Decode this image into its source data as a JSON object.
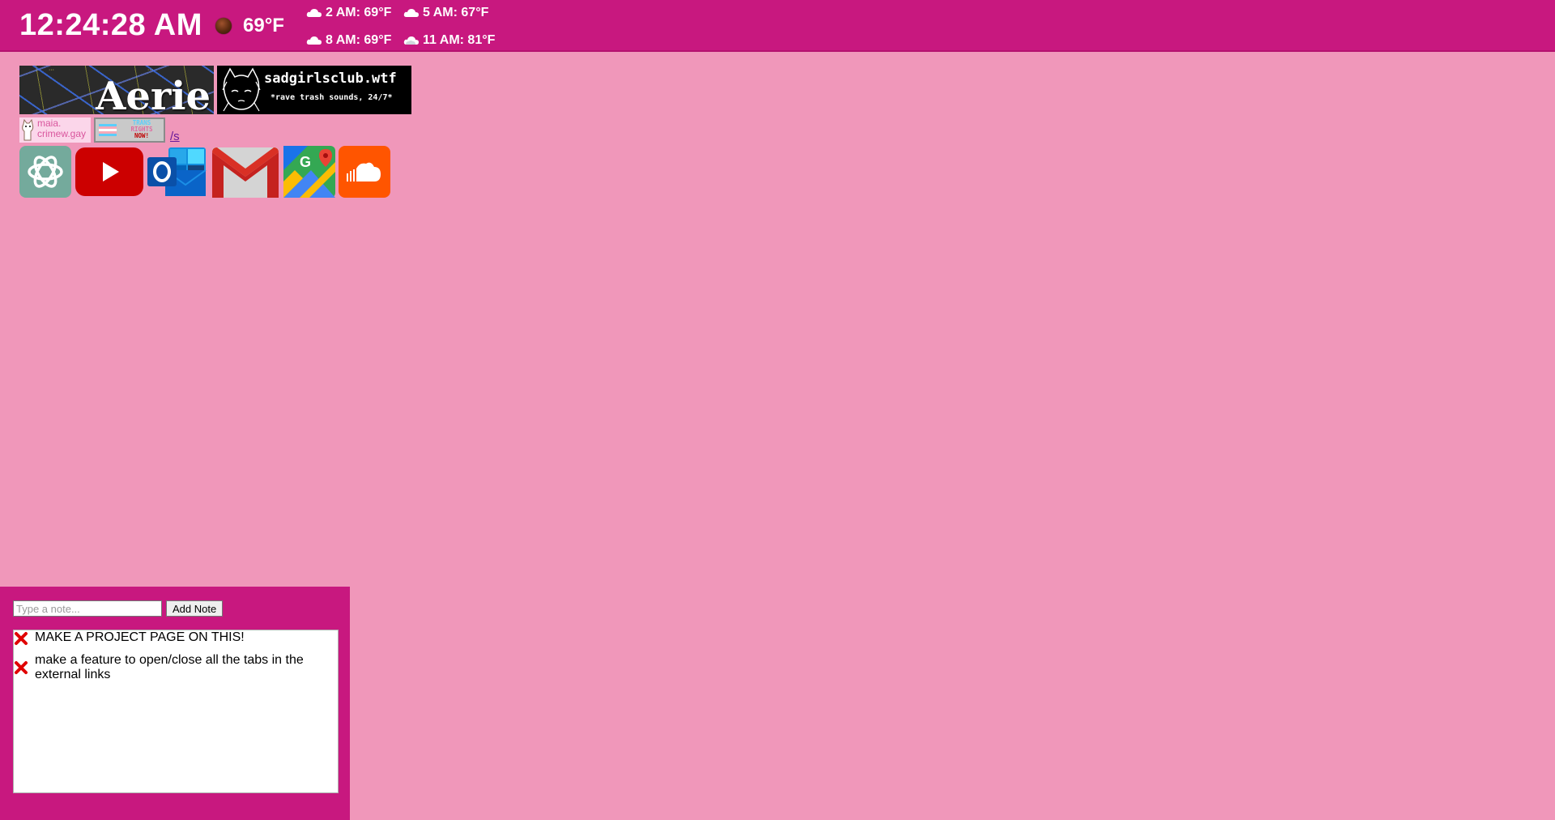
{
  "topbar": {
    "time": "12:24:28 AM",
    "current_temp": "69°F",
    "current_icon": "moon-icon",
    "forecast": [
      {
        "label": "2 AM: 69°F",
        "icon": "cloud-icon"
      },
      {
        "label": "5 AM: 67°F",
        "icon": "cloud-icon"
      },
      {
        "label": "8 AM: 69°F",
        "icon": "cloud-icon"
      },
      {
        "label": "11 AM: 81°F",
        "icon": "partly-cloudy-icon"
      }
    ]
  },
  "banners": {
    "aerie": {
      "title": "Aerie"
    },
    "sadgirls": {
      "title": "sadgirlsclub.wtf",
      "subtitle": "*rave trash sounds, 24/7*"
    }
  },
  "buttons": {
    "maia": {
      "line1": "maia.",
      "line2": "crimew.gay"
    },
    "trans": {
      "line1": "TRANS",
      "line2": "RIGHTS",
      "line3": "NOW!"
    },
    "slash_link": "/s"
  },
  "apps": [
    {
      "name": "chatgpt",
      "icon": "chatgpt-icon",
      "color": "#74aa9c"
    },
    {
      "name": "youtube",
      "icon": "youtube-icon",
      "color": "#cc0000"
    },
    {
      "name": "outlook",
      "icon": "outlook-icon",
      "color": "#0a64c8"
    },
    {
      "name": "gmail",
      "icon": "gmail-icon",
      "color": "#d93025"
    },
    {
      "name": "maps",
      "icon": "google-maps-icon",
      "color": "#34a853"
    },
    {
      "name": "soundcloud",
      "icon": "soundcloud-icon",
      "color": "#ff5500"
    }
  ],
  "notes": {
    "placeholder": "Type a note...",
    "add_label": "Add Note",
    "items": [
      "MAKE A PROJECT PAGE ON THIS!",
      "make a feature to open/close all the tabs in the external links"
    ]
  },
  "colors": {
    "topbar_bg": "#c8187f",
    "page_bg": "#f097ba"
  }
}
